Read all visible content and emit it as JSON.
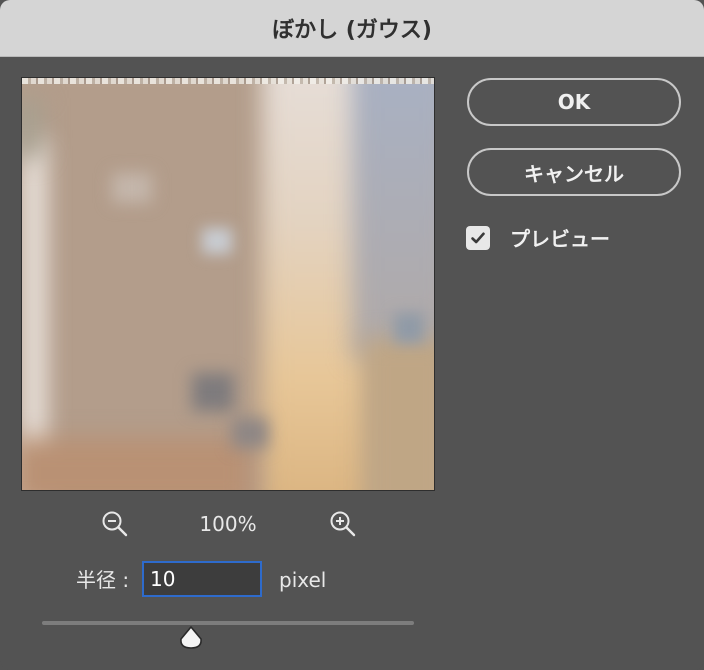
{
  "dialog": {
    "title": "ぼかし (ガウス)"
  },
  "buttons": {
    "ok": "OK",
    "cancel": "キャンセル"
  },
  "preview_checkbox": {
    "label": "プレビュー",
    "checked": true
  },
  "zoom": {
    "level": "100%",
    "zoom_out_icon": "zoom-out-icon",
    "zoom_in_icon": "zoom-in-icon"
  },
  "radius": {
    "label": "半径 :",
    "value": "10",
    "unit": "pixel",
    "slider_fraction": 0.4
  },
  "colors": {
    "dialog_bg": "#535353",
    "titlebar_bg": "#d5d5d5",
    "input_focus_border": "#2e6bcc"
  }
}
